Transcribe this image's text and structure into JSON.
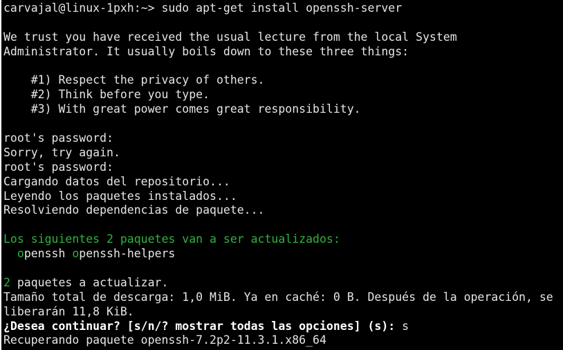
{
  "terminal": {
    "prompt": "carvajal@linux-1pxh:~> ",
    "command": "sudo apt-get install openssh-server",
    "lecture": {
      "line1": "We trust you have received the usual lecture from the local System",
      "line2": "Administrator. It usually boils down to these three things:",
      "rule1": "    #1) Respect the privacy of others.",
      "rule2": "    #2) Think before you type.",
      "rule3": "    #3) With great power comes great responsibility."
    },
    "password_prompt_1": "root's password:",
    "sorry": "Sorry, try again.",
    "password_prompt_2": "root's password:",
    "loading_repo": "Cargando datos del repositorio...",
    "reading_installed": "Leyendo los paquetes instalados...",
    "resolving_deps": "Resolviendo dependencias de paquete...",
    "packages_heading": "Los siguientes 2 paquetes van a ser actualizados:",
    "packages": [
      {
        "initial": "o",
        "rest": "penssh"
      },
      {
        "initial": "o",
        "rest": "penssh-helpers"
      }
    ],
    "count_number": "2",
    "count_text": " paquetes a actualizar.",
    "download_line_1": "Tamaño total de descarga: 1,0 MiB. Ya en caché: 0 B. Después de la operación, se",
    "download_line_2": "liberarán 11,8 KiB.",
    "continue_question": "¿Desea continuar? [s/n/? mostrar todas las opciones] (s): ",
    "continue_answer": "s",
    "retrieving": "Recuperando paquete openssh-7.2p2-11.3.1.x86_64"
  },
  "colors": {
    "background": "#000000",
    "foreground": "#e6e6e6",
    "highlight_green": "#2fb43c",
    "bold_white": "#ffffff"
  }
}
